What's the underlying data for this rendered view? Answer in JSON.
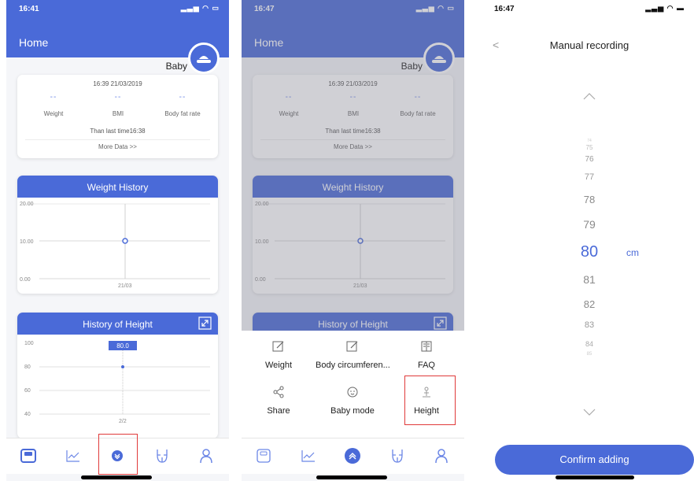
{
  "panel1": {
    "status_time": "16:41",
    "header_title": "Home",
    "baby_label": "Baby",
    "card_time": "16:39 21/03/2019",
    "metrics": [
      {
        "value": "--",
        "label": "Weight"
      },
      {
        "value": "--",
        "label": "BMI"
      },
      {
        "value": "--",
        "label": "Body fat rate"
      }
    ],
    "than_last": "Than last time16:38",
    "more_data": "More Data >>",
    "weight_history_title": "Weight History",
    "weight_chart": {
      "y_ticks": [
        "20.00",
        "10.00",
        "0.00"
      ],
      "x_label": "21/03"
    },
    "height_history_title": "History of Height",
    "height_chart": {
      "y_ticks": [
        "100",
        "80",
        "60",
        "40"
      ],
      "x_label": "2/2",
      "tooltip": "80.0"
    }
  },
  "panel2": {
    "status_time": "16:47",
    "header_title": "Home",
    "baby_label": "Baby",
    "card_time": "16:39 21/03/2019",
    "metrics": [
      {
        "value": "--",
        "label": "Weight"
      },
      {
        "value": "--",
        "label": "BMI"
      },
      {
        "value": "--",
        "label": "Body fat rate"
      }
    ],
    "than_last": "Than last time16:38",
    "more_data": "More Data >>",
    "weight_history_title": "Weight History",
    "weight_chart": {
      "y_ticks": [
        "20.00",
        "10.00",
        "0.00"
      ],
      "x_label": "21/03"
    },
    "height_history_title": "History of Height",
    "menu": [
      {
        "label": "Weight",
        "icon": "edit-icon"
      },
      {
        "label": "Body circumferen...",
        "icon": "edit-icon"
      },
      {
        "label": "FAQ",
        "icon": "book-icon"
      },
      {
        "label": "Share",
        "icon": "share-icon"
      },
      {
        "label": "Baby mode",
        "icon": "baby-face-icon"
      },
      {
        "label": "Height",
        "icon": "height-icon"
      }
    ]
  },
  "panel3": {
    "status_time": "16:47",
    "title": "Manual recording",
    "picker_values": [
      "74",
      "75",
      "76",
      "77",
      "78",
      "79",
      "80",
      "81",
      "82",
      "83",
      "84",
      "85"
    ],
    "selected_value": "80",
    "unit": "cm",
    "confirm_label": "Confirm adding"
  },
  "chart_data": [
    {
      "type": "line",
      "title": "Weight History",
      "x": [
        "21/03"
      ],
      "series": [
        {
          "values": [
            10
          ]
        }
      ],
      "ylim": [
        0,
        20
      ],
      "yticks": [
        0,
        10,
        20
      ]
    },
    {
      "type": "line",
      "title": "History of Height",
      "x": [
        "2/2"
      ],
      "series": [
        {
          "values": [
            80
          ]
        }
      ],
      "ylim": [
        40,
        100
      ],
      "yticks": [
        40,
        60,
        80,
        100
      ]
    }
  ],
  "colors": {
    "brand": "#4a6ad8",
    "highlight": "#e03a3a"
  }
}
